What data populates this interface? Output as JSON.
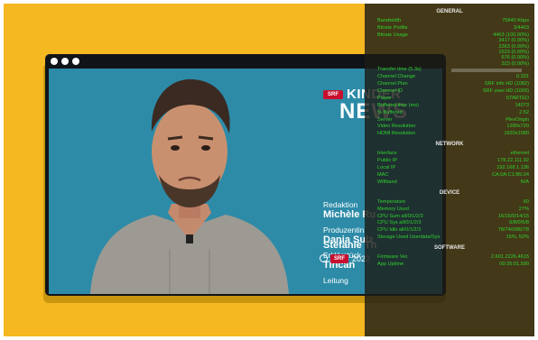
{
  "player": {
    "credits": {
      "brand_badge": "SRF",
      "brand_top": "KINDER",
      "brand_bottom": "NEWS",
      "entries": [
        {
          "label": "Redaktion",
          "name": "Michèle Ru"
        },
        {
          "label": "Produzentin",
          "name": "Dania Sulz"
        },
        {
          "label": "Erklärstück",
          "name": "Tincan"
        },
        {
          "label": "Leitung",
          "name": "Stefanie Th"
        }
      ],
      "footer_badge": "SRF",
      "footer_year": "2022"
    }
  },
  "stats": {
    "sections": [
      {
        "title": "GENERAL",
        "rows": [
          {
            "key": "Bandwidth",
            "value": "75840 Kbps"
          },
          {
            "key": "Bitrate Profile",
            "value": "3/4463"
          },
          {
            "key": "Bitrate Usage",
            "value": "4463 (100.00%)"
          },
          {
            "key": "",
            "value": "3417 (0.00%)"
          },
          {
            "key": "",
            "value": "2363 (0.00%)"
          },
          {
            "key": "",
            "value": "1623 (0.00%)"
          },
          {
            "key": "",
            "value": "676 (0.00%)"
          },
          {
            "key": "",
            "value": "323 (0.00%)"
          },
          {
            "key": "Transfer time (5.3s)",
            "value": ""
          },
          {
            "key": "Channel Change",
            "value": "0.331"
          },
          {
            "key": "Channel Plan",
            "value": "SRF info HD (1082)"
          },
          {
            "key": "Channel ID",
            "value": "SRF zwei HD (1009)"
          },
          {
            "key": "Player",
            "value": "STARTED"
          },
          {
            "key": "Buffered time (ms)",
            "value": "14073"
          },
          {
            "key": "% Buffered",
            "value": "2.52"
          },
          {
            "key": "Server",
            "value": "PlexOrigin"
          },
          {
            "key": "Video Resolution",
            "value": "1280x720"
          },
          {
            "key": "HDMI Resolution",
            "value": "1920x1080"
          }
        ]
      },
      {
        "title": "NETWORK",
        "rows": [
          {
            "key": "Interface",
            "value": "ethernet"
          },
          {
            "key": "Public IP",
            "value": "178.22.111.92"
          },
          {
            "key": "Local IP",
            "value": "192.168.1.136"
          },
          {
            "key": "MAC",
            "value": "CA:0A:C1:B5:24"
          },
          {
            "key": "Wifiband",
            "value": "N/A"
          }
        ]
      },
      {
        "title": "DEVICE",
        "rows": [
          {
            "key": "Temperature",
            "value": "60"
          },
          {
            "key": "Memory Used",
            "value": "27%"
          },
          {
            "key": "CPU Sum all/0/1/2/3",
            "value": "16/16/0/14/15"
          },
          {
            "key": "CPU Sys all/0/1/2/3",
            "value": "6/8/0/5/8"
          },
          {
            "key": "CPU Idle all/0/1/2/3",
            "value": "78/74/0/80/78"
          },
          {
            "key": "Storage Used Userdata/Sys",
            "value": "15%, 52%"
          }
        ]
      },
      {
        "title": "SOFTWARE",
        "rows": [
          {
            "key": "Firmware Ver.",
            "value": "2.601.2226.4615"
          },
          {
            "key": "App Uptime",
            "value": "00:25:01.590"
          }
        ]
      }
    ],
    "transfer_progress": 0.0
  },
  "colors": {
    "background": "#f5b820",
    "stats_text": "#2fd32f",
    "video_bg": "#2d8ba8",
    "brand_red": "#c8102e"
  }
}
